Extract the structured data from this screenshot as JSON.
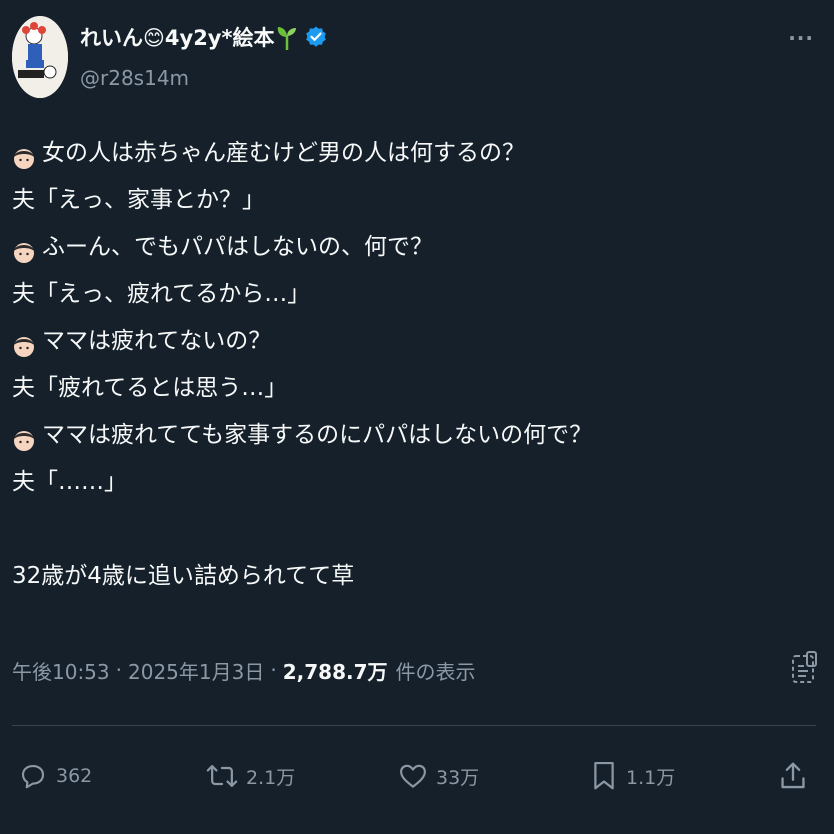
{
  "author": {
    "display_name": "れいん😊4y2y*絵本",
    "handle": "@r28s14m",
    "verified": true
  },
  "menu": {
    "more_label": "···"
  },
  "tweet": {
    "lines": [
      {
        "speaker": "child",
        "text": "女の人は赤ちゃん産むけど男の人は何するの？"
      },
      {
        "speaker": "text",
        "text": "夫「えっ、家事とか？」"
      },
      {
        "speaker": "child",
        "text": "ふーん、でもパパはしないの、何で？"
      },
      {
        "speaker": "text",
        "text": "夫「えっ、疲れてるから…」"
      },
      {
        "speaker": "child",
        "text": "ママは疲れてないの？"
      },
      {
        "speaker": "text",
        "text": "夫「疲れてるとは思う…」"
      },
      {
        "speaker": "child",
        "text": "ママは疲れてても家事するのにパパはしないの何で？"
      },
      {
        "speaker": "text",
        "text": "夫「……」"
      }
    ],
    "closing": "32歳が4歳に追い詰められてて草"
  },
  "meta": {
    "time": "午後10:53",
    "date": "2025年1月3日",
    "views_count": "2,788.7万",
    "views_label": "件の表示",
    "separator": "·"
  },
  "actions": {
    "replies": "362",
    "reposts": "2.1万",
    "likes": "33万",
    "bookmarks": "1.1万"
  },
  "colors": {
    "background": "#15202b",
    "text": "#f7f9f9",
    "secondary": "#8b98a5",
    "verified": "#1d9bf0",
    "divider": "#38444d"
  }
}
